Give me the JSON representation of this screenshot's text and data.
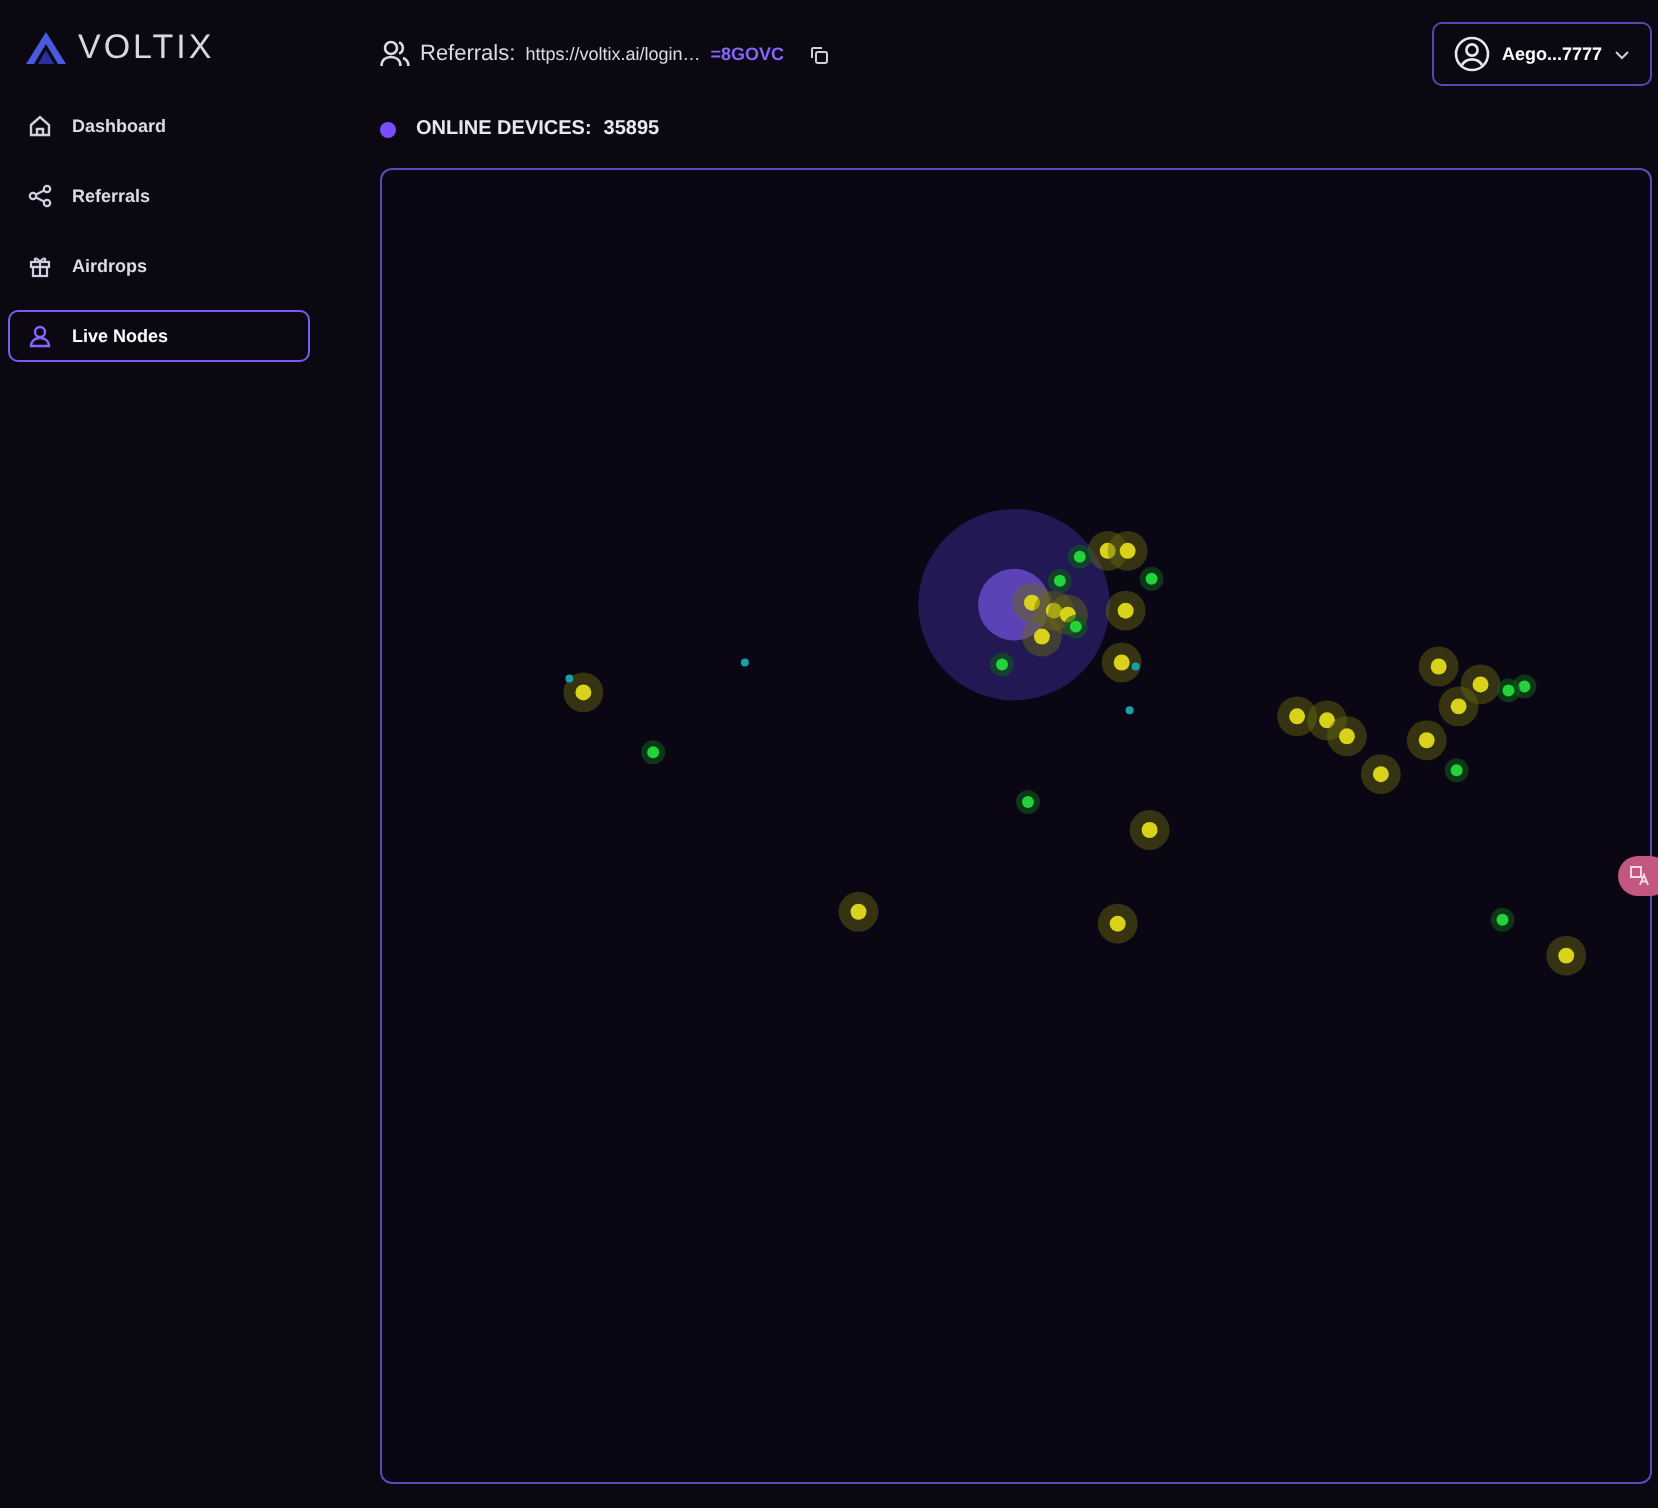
{
  "brand": {
    "name": "VOLTIX"
  },
  "sidebar": {
    "items": [
      {
        "label": "Dashboard",
        "kind": "home",
        "selected": false
      },
      {
        "label": "Referrals",
        "kind": "share",
        "selected": false
      },
      {
        "label": "Airdrops",
        "kind": "gift",
        "selected": false
      },
      {
        "label": "Live Nodes",
        "kind": "node",
        "selected": true
      }
    ]
  },
  "header": {
    "referrals_label": "Referrals:",
    "referral_link": "https://voltix.ai/login…",
    "referral_code": "=8GOVC",
    "account": "Aego...7777"
  },
  "status": {
    "label": "ONLINE DEVICES:",
    "count": "35895"
  }
}
